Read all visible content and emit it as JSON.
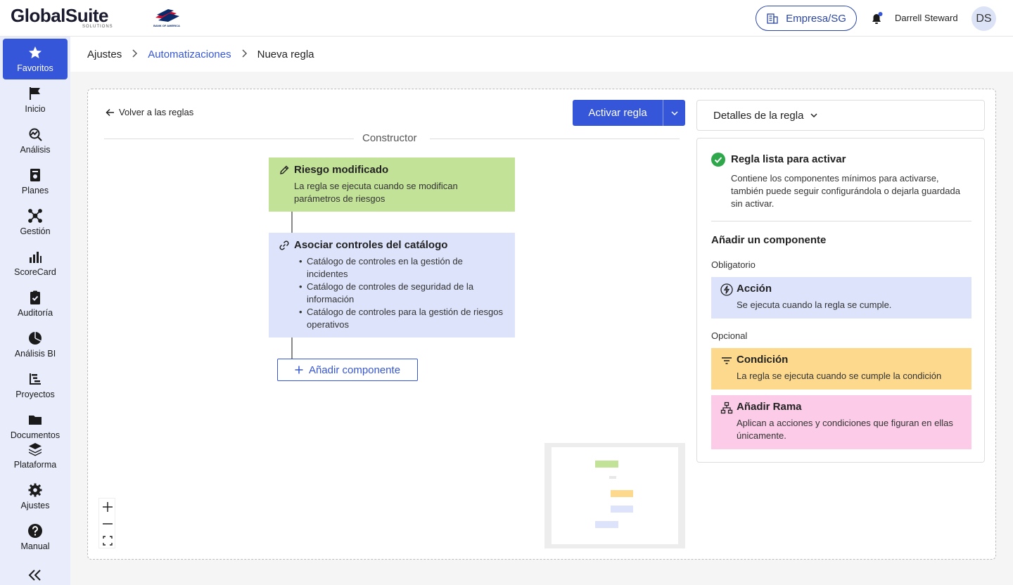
{
  "header": {
    "logo_text": "GlobalSuite",
    "logo_sub": "SOLUTIONS",
    "partner_logo_text": "BANK OF AMERICA",
    "company_label": "Empresa/SG",
    "user_name": "Darrell Steward",
    "avatar_initials": "DS"
  },
  "sidebar": {
    "items": [
      {
        "label": "Favoritos",
        "icon": "star-icon"
      },
      {
        "label": "Inicio",
        "icon": "flag-icon"
      },
      {
        "label": "Análisis",
        "icon": "analysis-icon"
      },
      {
        "label": "Planes",
        "icon": "planes-icon"
      },
      {
        "label": "Gestión",
        "icon": "network-icon"
      },
      {
        "label": "ScoreCard",
        "icon": "bar-chart-icon"
      },
      {
        "label": "Auditoría",
        "icon": "clipboard-check-icon"
      },
      {
        "label": "Análisis BI",
        "icon": "pie-chart-icon"
      },
      {
        "label": "Proyectos",
        "icon": "gantt-icon"
      },
      {
        "label": "Documentos",
        "icon": "folder-icon"
      },
      {
        "label": "Plataforma",
        "icon": "layers-icon"
      },
      {
        "label": "Ajustes",
        "icon": "gear-icon"
      },
      {
        "label": "Manual",
        "icon": "help-icon"
      }
    ],
    "active": "Favoritos"
  },
  "breadcrumb": {
    "items": [
      "Ajustes",
      "Automatizaciones",
      "Nueva regla"
    ]
  },
  "builder": {
    "back_label": "Volver a las reglas",
    "activate_label": "Activar regla",
    "section_label": "Constructor",
    "trigger": {
      "title": "Riesgo modificado",
      "description": "La regla se ejecuta cuando se modifican parámetros de riesgos"
    },
    "action": {
      "title": "Asociar controles del catálogo",
      "items": [
        "Catálogo de controles en la gestión de incidentes",
        "Catálogo de controles de seguridad de la información",
        "Catálogo de controles para la gestión de riesgos operativos"
      ]
    },
    "add_component_label": "Añadir componente"
  },
  "details": {
    "header_label": "Detalles de la regla",
    "ready_title": "Regla lista para activar",
    "ready_desc": "Contiene los componentes mínimos para activarse, también puede seguir configurándola o dejarla guardada sin activar.",
    "add_title": "Añadir un componente",
    "mandatory_label": "Obligatorio",
    "optional_label": "Opcional",
    "components": {
      "accion": {
        "title": "Acción",
        "desc": "Se ejecuta cuando la regla se cumple."
      },
      "condicion": {
        "title": "Condición",
        "desc": "La regla se ejecuta cuando se cumple la condición"
      },
      "rama": {
        "title": "Añadir Rama",
        "desc": "Aplican a acciones y condiciones que figuran en ellas únicamente."
      }
    }
  },
  "colors": {
    "accent": "#3656d9",
    "trigger_green": "#c2e298",
    "action_blue": "#dce3fb",
    "condition_yellow": "#fcd98c",
    "branch_pink": "#fbcbe7",
    "success_green": "#2ea84a"
  }
}
